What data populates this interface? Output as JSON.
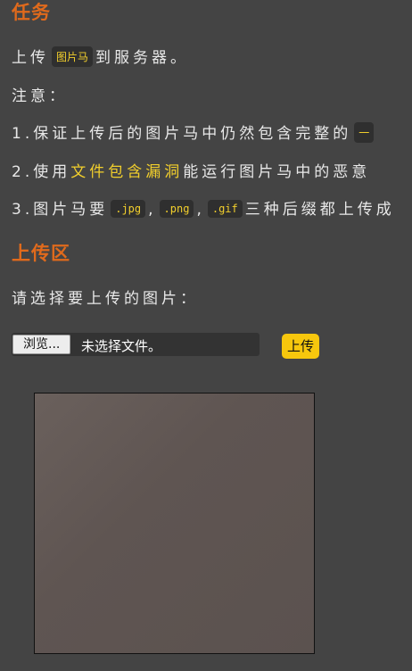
{
  "task": {
    "heading": "任务",
    "intro_before": "上传",
    "intro_code": "图片马",
    "intro_after": "到服务器。",
    "note_label": "注意：",
    "item1_text": "1.保证上传后的图片马中仍然包含完整的",
    "item1_code": "一",
    "item2_prefix": "2.使用",
    "item2_highlight": "文件包含漏洞",
    "item2_suffix": "能运行图片马中的恶意",
    "item3_prefix": "3.图片马要",
    "item3_ext1": ".jpg",
    "item3_sep1": ",",
    "item3_ext2": ".png",
    "item3_sep2": ",",
    "item3_ext3": ".gif",
    "item3_suffix": "三种后缀都上传成"
  },
  "upload": {
    "heading": "上传区",
    "prompt": "请选择要上传的图片：",
    "browse_label": "浏览...",
    "file_status": "未选择文件。",
    "upload_label": "上传"
  },
  "colors": {
    "background": "#444444",
    "heading": "#e06a1c",
    "highlight": "#f2cf2c",
    "upload_button": "#f7c70d"
  }
}
